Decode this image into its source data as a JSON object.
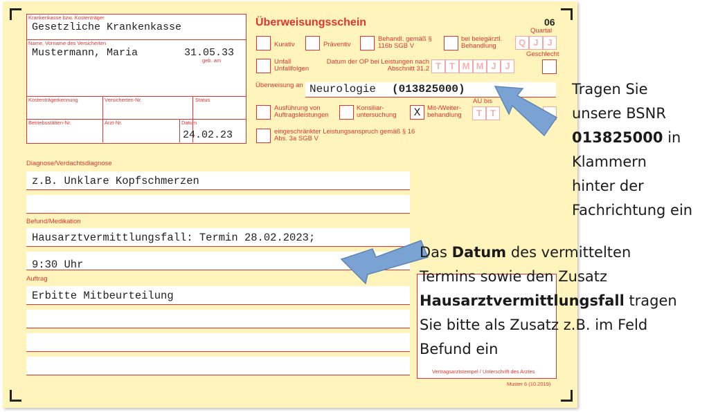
{
  "form": {
    "title": "Überweisungsschein",
    "form_code": "06",
    "quartal_label": "Quartal",
    "geschlecht_label": "Geschlecht",
    "kasse_label": "Krankenkasse bzw. Kostenträger",
    "kasse_value": "Gesetzliche Krankenkasse",
    "name_label": "Name, Vorname des Versicherten",
    "name_value": "Mustermann, Maria",
    "birth_value": "31.05.33",
    "birth_label": "geb. am",
    "kostentraeger_label": "Kostenträgerkennung",
    "versicherten_label": "Versicherten-Nr.",
    "status_label": "Status",
    "betriebsstaetten_label": "Betriebsstätten-Nr.",
    "arzt_label": "Arzt-Nr.",
    "datum_label": "Datum",
    "datum_value": "24.02.23",
    "kurativ_label": "Kurativ",
    "praeventiv_label": "Präventiv",
    "behandl_label": "Behandl. gemäß § 116b SGB V",
    "beleg_label": "bei belegärztl. Behandlung",
    "unfall_label": "Unfall Unfallfolgen",
    "op_label": "Datum der OP bei Leistungen nach Abschnitt 31.2",
    "op_letters": [
      "T",
      "T",
      "M",
      "M",
      "J",
      "J"
    ],
    "quartal_letters": [
      "Q",
      "J",
      "J"
    ],
    "ueberweisung_label": "Überweisung an",
    "ueberweisung_value_plain": "Neurologie ",
    "ueberweisung_value_bold": "(013825000)",
    "ausfuehrung_label": "Ausführung von Auftragsleistungen",
    "konsiliar_label": "Konsiliar-untersuchung",
    "mitweiter_label": "Mit-/Weiter-behandlung",
    "mitweiter_mark": "X",
    "au_label": "AU bis",
    "au_letters": [
      "T",
      "T"
    ],
    "eingeschraenkt_label": "eingeschränkter Leistungsanspruch gemäß § 16 Abs. 3a SGB V",
    "diagnose_label": "Diagnose/Verdachtsdiagnose",
    "diagnose_lines": [
      "z.B. Unklare Kopfschmerzen",
      ""
    ],
    "befund_label": "Befund/Medikation",
    "befund_lines": [
      "Hausarztvermittlungsfall: Termin 28.02.2023;",
      "9:30 Uhr"
    ],
    "auftrag_label": "Auftrag",
    "auftrag_lines": [
      "Erbitte Mitbeurteilung",
      "",
      "",
      ""
    ],
    "stempel_label": "Vertragsarztstempel / Unterschrift des Arztes",
    "muster_label": "Muster 6 (10.2019)"
  },
  "annotations": {
    "bsnr": {
      "l1": "Tragen Sie",
      "l2": "unsere BSNR",
      "l3_bold": "013825000",
      "l3_rest": " in",
      "l4": "Klammern",
      "l5": "hinter der",
      "l6": "Fachrichtung ein"
    },
    "datum": {
      "l1_pre": "Das ",
      "l1_bold": "Datum",
      "l1_post": " des vermittelten",
      "l2": "Termins sowie den Zusatz",
      "l3_bold": "Hausarztvermittlungsfall",
      "l3_post": " tragen",
      "l4": "Sie bitte als Zusatz z.B. im Feld",
      "l5": "Befund ein"
    }
  },
  "colors": {
    "form_bg": "#fff5bc",
    "form_red": "#e2342f",
    "arrow": "#7aa3d4"
  }
}
